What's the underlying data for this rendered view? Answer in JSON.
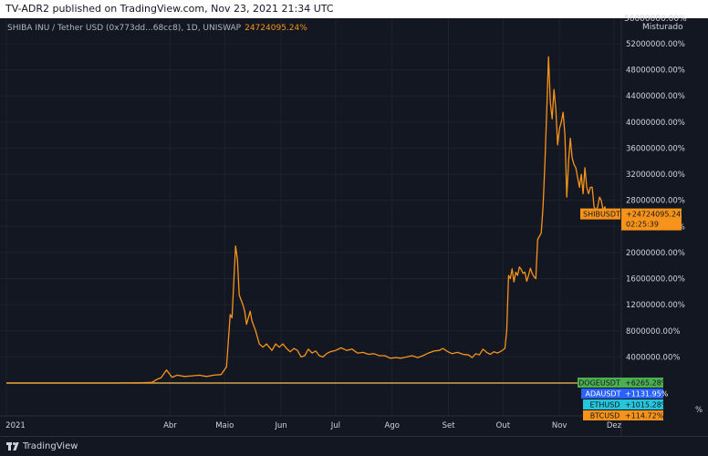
{
  "header": {
    "published": "TV-ADR2 published on TradingView.com, Nov 23, 2021 21:34 UTC"
  },
  "symbol": {
    "description": "SHIBA INU / Tether USD (0x773dd...68cc8), 1D, UNISWAP",
    "change": "24724095.24%"
  },
  "scale": {
    "top_label": "56000000.00%",
    "mode": "Misturado"
  },
  "footer": {
    "brand": "TradingView"
  },
  "colors": {
    "background": "#131722",
    "shib": "#f7931a",
    "doge": "#4caf50",
    "ada": "#2962ff",
    "eth": "#26c6da",
    "btc": "#f7931a",
    "grid": "#1e222d"
  },
  "chart_data": {
    "type": "line",
    "ylim": [
      0,
      56000000
    ],
    "ytick_values": [
      4000000,
      8000000,
      12000000,
      16000000,
      20000000,
      24000000,
      28000000,
      32000000,
      36000000,
      40000000,
      44000000,
      48000000,
      52000000
    ],
    "ytick_labels": [
      "4000000.00%",
      "8000000.00%",
      "12000000.00%",
      "16000000.00%",
      "20000000.00%",
      "24000000.00%",
      "28000000.00%",
      "32000000.00%",
      "36000000.00%",
      "40000000.00%",
      "44000000.00%",
      "48000000.00%",
      "52000000.00%"
    ],
    "bottom_partial_tick": "%",
    "xticks": [
      {
        "label": "2021",
        "day": 0
      },
      {
        "label": "Abr",
        "day": 90
      },
      {
        "label": "Maio",
        "day": 120
      },
      {
        "label": "Jun",
        "day": 151
      },
      {
        "label": "Jul",
        "day": 181
      },
      {
        "label": "Ago",
        "day": 212
      },
      {
        "label": "Set",
        "day": 243
      },
      {
        "label": "Out",
        "day": 273
      },
      {
        "label": "Nov",
        "day": 304
      },
      {
        "label": "Dez",
        "day": 334
      }
    ],
    "series": [
      {
        "name": "SHIBUSDT",
        "value_label": "+24724095.24%",
        "countdown": "02:25:39",
        "color": "#f7931a",
        "points": [
          [
            0,
            0
          ],
          [
            30,
            0
          ],
          [
            60,
            0
          ],
          [
            75,
            50000
          ],
          [
            80,
            100000
          ],
          [
            83,
            600000
          ],
          [
            85,
            800000
          ],
          [
            88,
            2000000
          ],
          [
            91,
            900000
          ],
          [
            94,
            1200000
          ],
          [
            98,
            1000000
          ],
          [
            102,
            1100000
          ],
          [
            106,
            1200000
          ],
          [
            110,
            1000000
          ],
          [
            114,
            1200000
          ],
          [
            118,
            1300000
          ],
          [
            121,
            2500000
          ],
          [
            123,
            10500000
          ],
          [
            124,
            10000000
          ],
          [
            126,
            21000000
          ],
          [
            127,
            19000000
          ],
          [
            128,
            13500000
          ],
          [
            130,
            12000000
          ],
          [
            131,
            11000000
          ],
          [
            132,
            9000000
          ],
          [
            134,
            11000000
          ],
          [
            135,
            9500000
          ],
          [
            137,
            8000000
          ],
          [
            139,
            6000000
          ],
          [
            141,
            5500000
          ],
          [
            143,
            6000000
          ],
          [
            146,
            5000000
          ],
          [
            148,
            6000000
          ],
          [
            150,
            5500000
          ],
          [
            152,
            6000000
          ],
          [
            154,
            5300000
          ],
          [
            156,
            4800000
          ],
          [
            158,
            5300000
          ],
          [
            160,
            5000000
          ],
          [
            162,
            4000000
          ],
          [
            164,
            4200000
          ],
          [
            166,
            5200000
          ],
          [
            168,
            4600000
          ],
          [
            170,
            4900000
          ],
          [
            172,
            4200000
          ],
          [
            174,
            4000000
          ],
          [
            176,
            4500000
          ],
          [
            178,
            4800000
          ],
          [
            181,
            5000000
          ],
          [
            184,
            5400000
          ],
          [
            187,
            5000000
          ],
          [
            190,
            5200000
          ],
          [
            193,
            4600000
          ],
          [
            196,
            4700000
          ],
          [
            199,
            4400000
          ],
          [
            202,
            4500000
          ],
          [
            205,
            4200000
          ],
          [
            208,
            4200000
          ],
          [
            211,
            3800000
          ],
          [
            214,
            3900000
          ],
          [
            217,
            3800000
          ],
          [
            220,
            4000000
          ],
          [
            223,
            4200000
          ],
          [
            226,
            3900000
          ],
          [
            229,
            4200000
          ],
          [
            232,
            4600000
          ],
          [
            235,
            4900000
          ],
          [
            238,
            5000000
          ],
          [
            240,
            5300000
          ],
          [
            242,
            4900000
          ],
          [
            245,
            4500000
          ],
          [
            248,
            4700000
          ],
          [
            251,
            4400000
          ],
          [
            254,
            4300000
          ],
          [
            256,
            3900000
          ],
          [
            258,
            4500000
          ],
          [
            260,
            4300000
          ],
          [
            262,
            5200000
          ],
          [
            264,
            4700000
          ],
          [
            266,
            4400000
          ],
          [
            268,
            4800000
          ],
          [
            270,
            4600000
          ],
          [
            272,
            4900000
          ],
          [
            274,
            5300000
          ],
          [
            275,
            8000000
          ],
          [
            276,
            16500000
          ],
          [
            277,
            16000000
          ],
          [
            278,
            17500000
          ],
          [
            279,
            15500000
          ],
          [
            280,
            17000000
          ],
          [
            281,
            16500000
          ],
          [
            282,
            17800000
          ],
          [
            283,
            17400000
          ],
          [
            284,
            16800000
          ],
          [
            285,
            17000000
          ],
          [
            286,
            15600000
          ],
          [
            287,
            16500000
          ],
          [
            288,
            17600000
          ],
          [
            289,
            16800000
          ],
          [
            290,
            16300000
          ],
          [
            291,
            16000000
          ],
          [
            292,
            22000000
          ],
          [
            293,
            22500000
          ],
          [
            294,
            23000000
          ],
          [
            295,
            27000000
          ],
          [
            296,
            33500000
          ],
          [
            297,
            41500000
          ],
          [
            298,
            50000000
          ],
          [
            299,
            43000000
          ],
          [
            300,
            40500000
          ],
          [
            301,
            45000000
          ],
          [
            302,
            42000000
          ],
          [
            303,
            36500000
          ],
          [
            304,
            39000000
          ],
          [
            305,
            40000000
          ],
          [
            306,
            41500000
          ],
          [
            307,
            38000000
          ],
          [
            308,
            28500000
          ],
          [
            309,
            34000000
          ],
          [
            310,
            37500000
          ],
          [
            311,
            34500000
          ],
          [
            312,
            33500000
          ],
          [
            313,
            33000000
          ],
          [
            314,
            31500000
          ],
          [
            315,
            30000000
          ],
          [
            316,
            32000000
          ],
          [
            317,
            29000000
          ],
          [
            318,
            33000000
          ],
          [
            319,
            30000000
          ],
          [
            320,
            29000000
          ],
          [
            321,
            30000000
          ],
          [
            322,
            30000000
          ],
          [
            323,
            27000000
          ],
          [
            324,
            26500000
          ],
          [
            325,
            27000000
          ],
          [
            326,
            28500000
          ],
          [
            327,
            28000000
          ],
          [
            328,
            26500000
          ],
          [
            329,
            27000000
          ],
          [
            330,
            25500000
          ]
        ]
      },
      {
        "name": "DOGEUSDT",
        "value_label": "+6265.28%",
        "color": "#4caf50",
        "value": 6265
      },
      {
        "name": "ADAUSDT",
        "value_label": "+1131.95%",
        "color": "#2962ff",
        "value": 1132
      },
      {
        "name": "ETHUSD",
        "value_label": "+1015.28%",
        "color": "#26c6da",
        "value": 1015
      },
      {
        "name": "BTCUSD",
        "value_label": "+114.72%",
        "color": "#f7931a",
        "value": 115
      }
    ]
  }
}
